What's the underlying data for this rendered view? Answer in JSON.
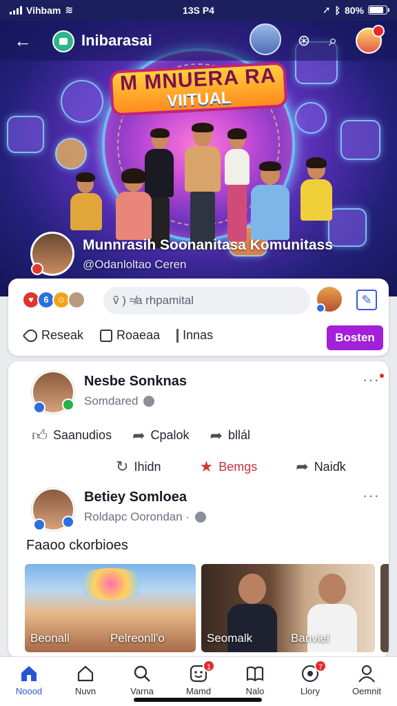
{
  "status": {
    "carrier": "Vihbam",
    "time": "13S P4",
    "battery": "80%",
    "battery_level": 0.8
  },
  "appbar": {
    "title": "Inibarasai"
  },
  "hero": {
    "banner_line1": "M MNUERA RA",
    "banner_line2": "VIITUAL",
    "community_name": "Munnrasih Soonanitasa Komunitass",
    "community_handle": "@Odanloltao Ceren"
  },
  "composer": {
    "placeholder": "ṽ ) ≉a rhpamital",
    "actions": [
      {
        "label": "Reseak",
        "icon": "tag-icon"
      },
      {
        "label": "Roaeaa",
        "icon": "checkbox-icon"
      },
      {
        "label": "Innas",
        "icon": "bar-icon"
      }
    ],
    "post_button": "Bosten"
  },
  "posts": [
    {
      "author": "Nesbe Sonknas",
      "subtitle": "Somdared",
      "actions": [
        {
          "label": "Saanudios",
          "icon": "like-icon"
        },
        {
          "label": "Cpalok",
          "icon": "share-icon"
        },
        {
          "label": "bllál",
          "icon": "forward-icon"
        }
      ],
      "secondary_actions": [
        {
          "label": "Ihidn",
          "icon": "refresh-icon"
        },
        {
          "label": "Bemgs",
          "icon": "star-icon"
        },
        {
          "label": "Naiɗk",
          "icon": "reply-icon"
        }
      ]
    },
    {
      "author": "Betiey Somloea",
      "subtitle": "Roldapc Oorondan ·",
      "text": "Faaoo ckorbioes",
      "photos": [
        {
          "caption": "Beonall"
        },
        {
          "caption": "Pelreonll'o"
        },
        {
          "caption": "Seomalk"
        },
        {
          "caption": "Banviel"
        }
      ]
    }
  ],
  "nav": [
    {
      "label": "Noood",
      "icon": "home-filled-icon",
      "badge": ""
    },
    {
      "label": "Nuvn",
      "icon": "home-outline-icon",
      "badge": ""
    },
    {
      "label": "Varna",
      "icon": "search-icon",
      "badge": ""
    },
    {
      "label": "Mamd",
      "icon": "smiley-icon",
      "badge": "1"
    },
    {
      "label": "Nalo",
      "icon": "book-icon",
      "badge": ""
    },
    {
      "label": "Llory",
      "icon": "eye-icon",
      "badge": "7"
    },
    {
      "label": "Oemnit",
      "icon": "profile-icon",
      "badge": ""
    }
  ],
  "colors": {
    "accent": "#a31fd8",
    "nav_active": "#2457d8",
    "hero_dark": "#1b1f5e",
    "badge": "#e52b2b"
  }
}
